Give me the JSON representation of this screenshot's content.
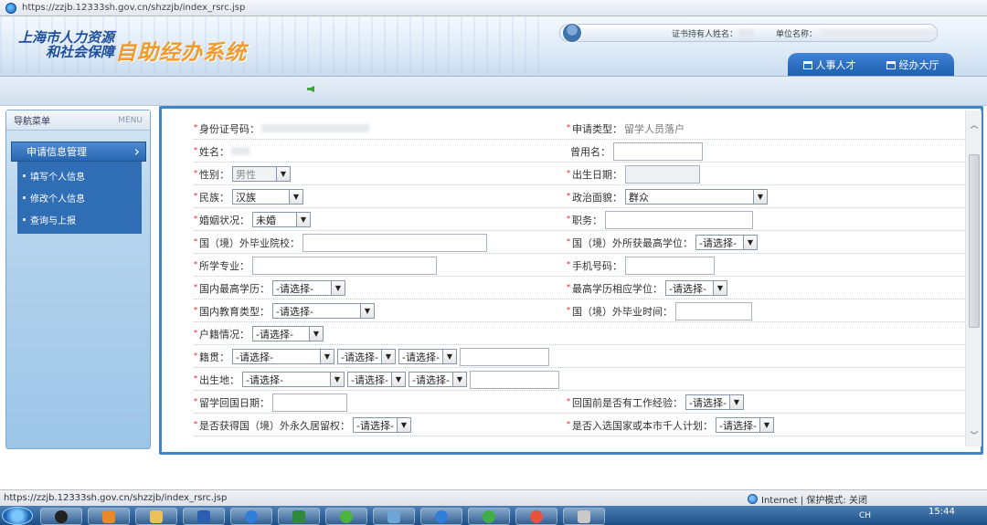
{
  "browser": {
    "url": "https://zzjb.12333sh.gov.cn/shzzjb/index_rsrc.jsp"
  },
  "header": {
    "org_line1": "上海市人力资源",
    "org_line2": "和社会保障",
    "system_title": "自助经办系统",
    "cert_holder_label": "证书持有人姓名：",
    "unit_label": "单位名称：",
    "tabs": [
      {
        "label": "人事人才",
        "icon": "briefcase-icon"
      },
      {
        "label": "经办大厅",
        "icon": "building-icon"
      }
    ]
  },
  "sidebar": {
    "title": "导航菜单",
    "title_en": "MENU",
    "selected": "申请信息管理",
    "items": [
      {
        "label": "填写个人信息"
      },
      {
        "label": "修改个人信息"
      },
      {
        "label": "查询与上报"
      }
    ]
  },
  "form": {
    "id_number_label": "身份证号码：",
    "application_type_label": "申请类型：",
    "application_type_value": "留学人员落户",
    "name_label": "姓名：",
    "former_name_label": "曾用名：",
    "gender_label": "性别：",
    "gender_value": "男性",
    "birth_date_label": "出生日期：",
    "ethnicity_label": "民族：",
    "ethnicity_value": "汉族",
    "political_status_label": "政治面貌：",
    "political_status_value": "群众",
    "marital_status_label": "婚姻状况：",
    "marital_status_value": "未婚",
    "position_label": "职务：",
    "overseas_school_label": "国（境）外毕业院校：",
    "overseas_degree_label": "国（境）外所获最高学位：",
    "major_label": "所学专业：",
    "mobile_label": "手机号码：",
    "domestic_education_label": "国内最高学历：",
    "highest_edu_degree_label": "最高学历相应学位：",
    "domestic_edu_type_label": "国内教育类型：",
    "overseas_grad_time_label": "国（境）外毕业时间：",
    "household_status_label": "户籍情况：",
    "native_place_label": "籍贯：",
    "birthplace_label": "出生地：",
    "return_date_label": "留学回国日期：",
    "work_exp_before_return_label": "回国前是否有工作经验：",
    "permanent_residency_label": "是否获得国（境）外永久居留权：",
    "talent_plan_label": "是否入选国家或本市千人计划：",
    "select_placeholder": "-请选择-"
  },
  "statusbar": {
    "url": "https://zzjb.12333sh.gov.cn/shzzjb/index_rsrc.jsp",
    "zone": "Internet | 保护模式: 关闭"
  },
  "taskbar": {
    "lang": "CH",
    "time": "15:44"
  }
}
